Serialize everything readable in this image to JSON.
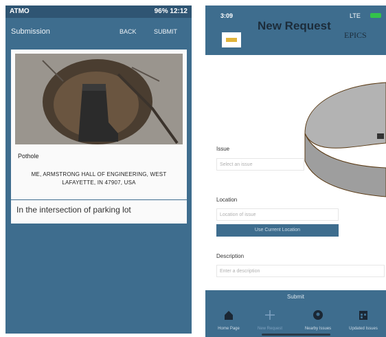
{
  "left": {
    "status": {
      "left": "ATMO",
      "right": "96% 12:12"
    },
    "appbar": {
      "title": "Submission",
      "back": "BACK",
      "submit": "SUBMIT"
    },
    "report": {
      "type": "Pothole",
      "address": "ME, ARMSTRONG HALL OF ENGINEERING, WEST LAFAYETTE, IN 47907, USA",
      "note": "In the intersection of parking lot"
    }
  },
  "right": {
    "status": {
      "time": "3:09",
      "signal": "LTE"
    },
    "header": {
      "title": "New Request",
      "subtitle": "EPICS"
    },
    "form": {
      "issue_label": "Issue",
      "issue_placeholder": "Select an issue",
      "location_label": "Location",
      "location_placeholder": "Location of issue",
      "current_location_button": "Use Current Location",
      "description_label": "Description",
      "description_placeholder": "Enter a description",
      "submit": "Submit"
    },
    "tabs": [
      {
        "label": "Home Page",
        "icon": "home-icon"
      },
      {
        "label": "New Request",
        "icon": "plus-icon",
        "active": true
      },
      {
        "label": "Nearby Issues",
        "icon": "map-pin-icon"
      },
      {
        "label": "Updated Issues",
        "icon": "calendar-icon"
      }
    ]
  },
  "colors": {
    "primary": "#3e6d8e",
    "overlay_fill": "#b3b3b3",
    "overlay_stroke": "#5a3a14"
  }
}
